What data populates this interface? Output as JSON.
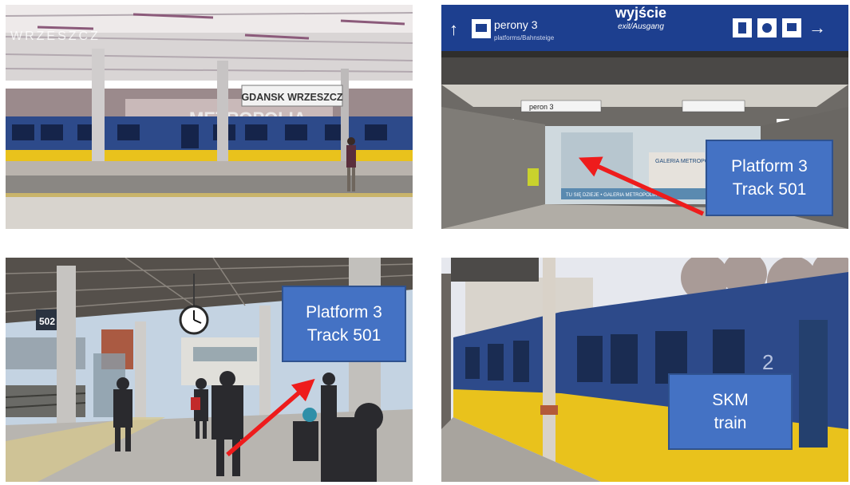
{
  "panels": {
    "top_left": {
      "station_sign": "GDANSK WRZESZCZ",
      "station_sign_faded": "WRZESZCZ",
      "building_text": "METROPOLIA"
    },
    "top_right": {
      "overhead_main": "wyjście",
      "overhead_sub": "exit/Ausgang",
      "overhead_left": "perony 3",
      "overhead_left_sub": "platforms/Bahnsteige",
      "small_sign": "peron 3",
      "ad_text": "GALERIA METROPOLIA",
      "ad_bottom": "TU SIĘ DZIEJE • GALERIA METROPOLIA",
      "callout": {
        "line1": "Platform 3",
        "line2": "Track 501"
      }
    },
    "bottom_left": {
      "track_sign": "502",
      "callout": {
        "line1": "Platform 3",
        "line2": "Track 501"
      }
    },
    "bottom_right": {
      "car_number": "2",
      "callout": {
        "line1": "SKM",
        "line2": "train"
      }
    }
  },
  "colors": {
    "callout_fill": "#4472c4",
    "callout_border": "#2f528f",
    "arrow": "#ee1c1c",
    "train_blue": "#2d4a8a",
    "train_yellow": "#e9c21c",
    "sign_blue": "#1d3f8f"
  }
}
